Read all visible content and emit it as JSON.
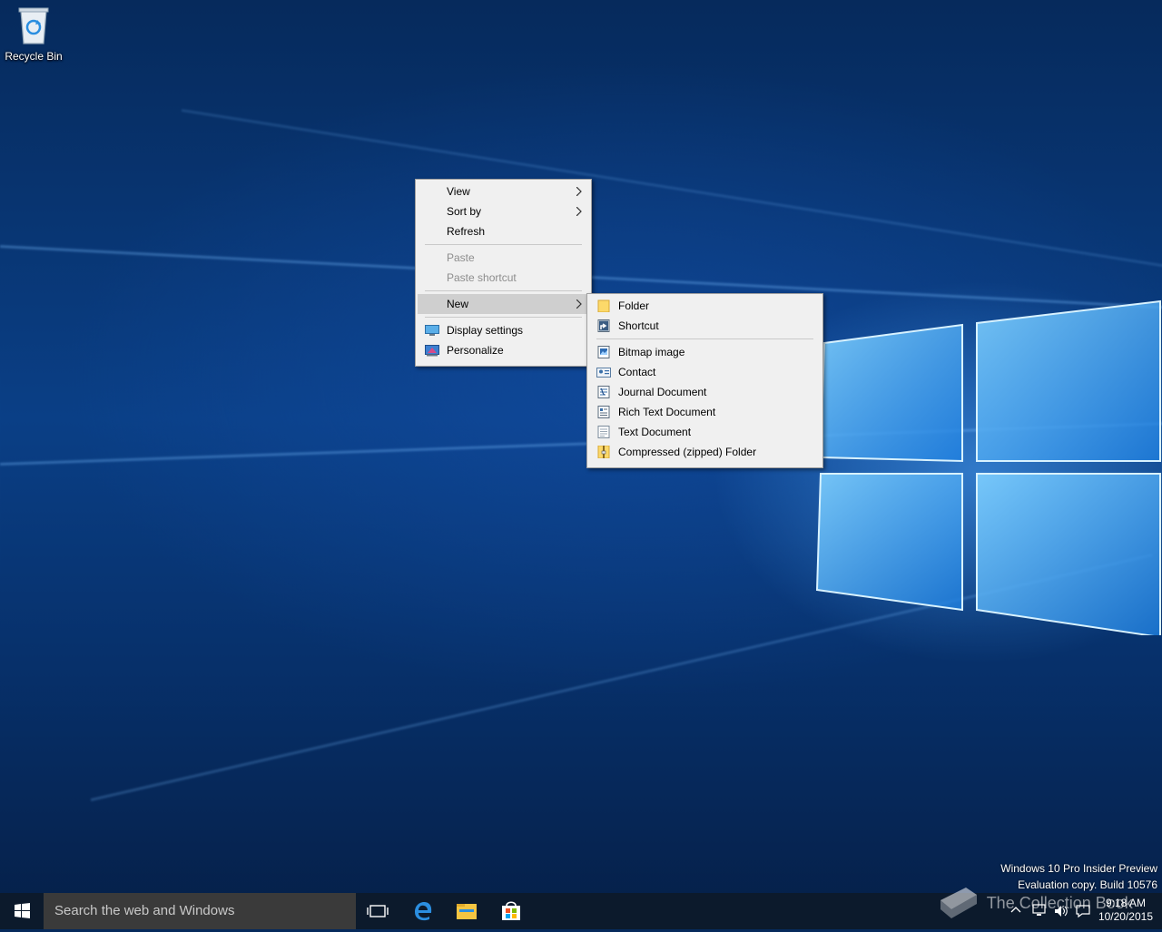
{
  "desktop": {
    "recycle_bin_label": "Recycle Bin",
    "edition_line1": "Windows 10 Pro Insider Preview",
    "edition_line2": "Evaluation copy. Build 10576",
    "watermark": "The Collection Book"
  },
  "context_menu": {
    "items": [
      {
        "label": "View"
      },
      {
        "label": "Sort by"
      },
      {
        "label": "Refresh"
      },
      {
        "label": "Paste"
      },
      {
        "label": "Paste shortcut"
      },
      {
        "label": "New"
      },
      {
        "label": "Display settings"
      },
      {
        "label": "Personalize"
      }
    ]
  },
  "new_submenu": {
    "items": [
      {
        "label": "Folder",
        "icon": "folder-icon"
      },
      {
        "label": "Shortcut",
        "icon": "shortcut-icon"
      },
      {
        "label": "Bitmap image",
        "icon": "bitmap-icon"
      },
      {
        "label": "Contact",
        "icon": "contact-icon"
      },
      {
        "label": "Journal Document",
        "icon": "journal-icon"
      },
      {
        "label": "Rich Text Document",
        "icon": "rich-text-icon"
      },
      {
        "label": "Text Document",
        "icon": "text-document-icon"
      },
      {
        "label": "Compressed (zipped) Folder",
        "icon": "zip-folder-icon"
      }
    ]
  },
  "taskbar": {
    "search_placeholder": "Search the web and Windows",
    "time": "9:18 AM",
    "date": "10/20/2015"
  },
  "colors": {
    "menu_bg": "#f0f0f0",
    "menu_hover": "#cfcfcf",
    "taskbar_bg": "#0c1a2c",
    "accent": "#0078d7"
  }
}
